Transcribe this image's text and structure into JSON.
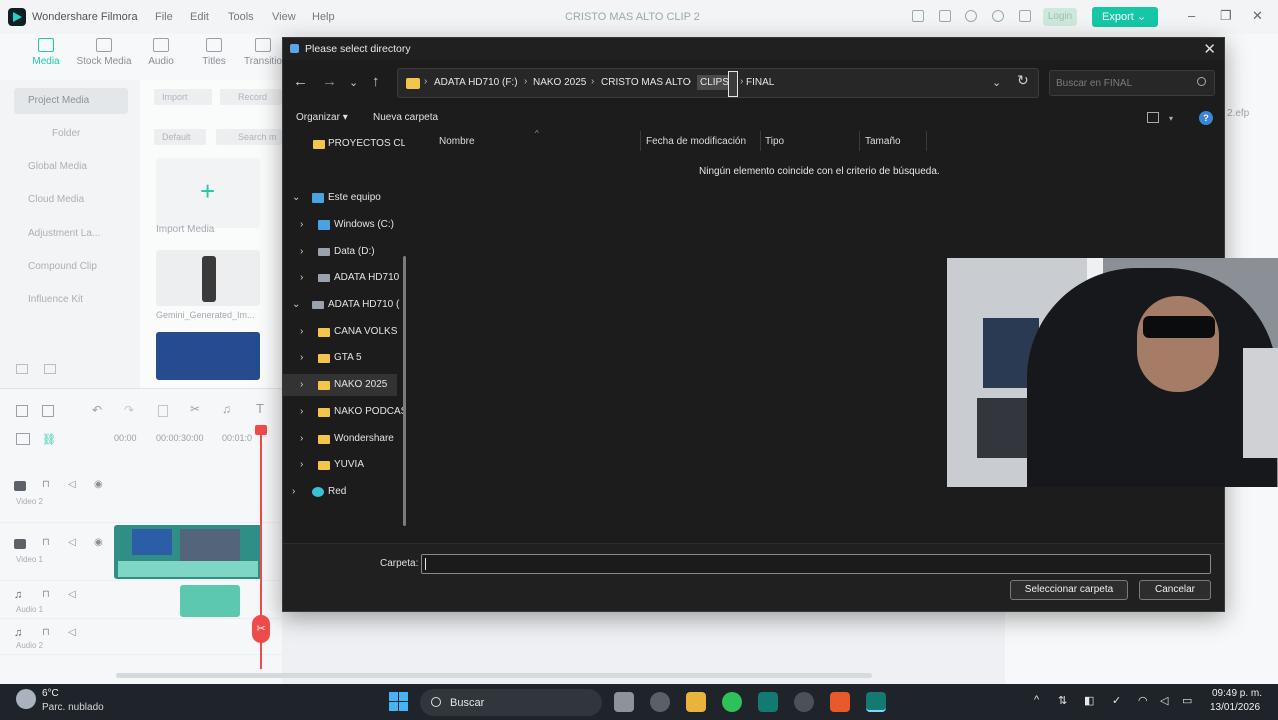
{
  "app": {
    "name": "Wondershare Filmora",
    "project_title": "CRISTO MAS ALTO CLIP 2",
    "menu": [
      "File",
      "Edit",
      "Tools",
      "View",
      "Help"
    ],
    "login_label": "Login",
    "export_label": "Export",
    "toolbar_tabs": [
      "Media",
      "Stock Media",
      "Audio",
      "Titles",
      "Transitio"
    ],
    "left_panel": [
      "Project Media",
      "Folder",
      "Global Media",
      "Cloud Media",
      "Adjustment La...",
      "Compound Clip",
      "Influence Kit"
    ],
    "media_controls": {
      "import": "Import",
      "record": "Record",
      "default": "Default",
      "search": "Search m"
    },
    "media_items": [
      "Import Media",
      "Gemini_Generated_Im..."
    ],
    "timeline_times": [
      "00:00",
      "00:00:30:00",
      "00:01:0"
    ],
    "track_labels": [
      "Video 2",
      "Video 1",
      "Audio 1",
      "Audio 2"
    ],
    "right_hint": "2.efp"
  },
  "dialog": {
    "title": "Please select directory",
    "breadcrumbs": [
      "ADATA HD710 (F:)",
      "NAKO 2025",
      "CRISTO MAS ALTO",
      "CLIPS",
      "FINAL"
    ],
    "search_placeholder": "Buscar en FINAL",
    "commands": {
      "organize": "Organizar",
      "new_folder": "Nueva carpeta"
    },
    "nav_tree": [
      {
        "label": "PROYECTOS CLI"
      },
      {
        "label": "Este equipo"
      },
      {
        "label": "Windows (C:)"
      },
      {
        "label": "Data (D:)"
      },
      {
        "label": "ADATA HD710"
      },
      {
        "label": "ADATA HD710 ("
      },
      {
        "label": "CANA VOLKS"
      },
      {
        "label": "GTA 5"
      },
      {
        "label": "NAKO 2025"
      },
      {
        "label": "NAKO PODCAS"
      },
      {
        "label": "Wondershare"
      },
      {
        "label": "YUVIA"
      },
      {
        "label": "Red"
      }
    ],
    "columns": [
      "Nombre",
      "Fecha de modificación",
      "Tipo",
      "Tamaño"
    ],
    "empty_message": "Ningún elemento coincide con el criterio de búsqueda.",
    "folder_label": "Carpeta:",
    "folder_value": "",
    "select_button": "Seleccionar carpeta",
    "cancel_button": "Cancelar"
  },
  "taskbar": {
    "weather_temp": "6°C",
    "weather_desc": "Parc. nublado",
    "search_label": "Buscar",
    "time": "09:49 p. m.",
    "date": "13/01/2026"
  },
  "colors": {
    "accent": "#14c8a6",
    "folder": "#f3c54b",
    "dialog_bg": "#1c1c1c"
  }
}
